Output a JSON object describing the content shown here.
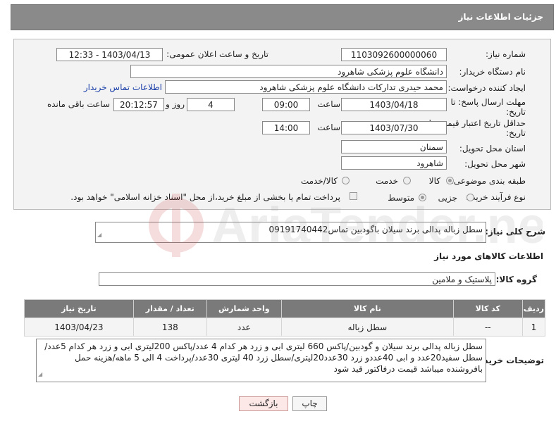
{
  "header": {
    "title": "جزئیات اطلاعات نیاز"
  },
  "form": {
    "need_number_label": "شماره نیاز:",
    "need_number": "1103092600000060",
    "announce_label": "تاریخ و ساعت اعلان عمومی:",
    "announce_value": "1403/04/13 - 12:33",
    "buyer_label": "نام دستگاه خریدار:",
    "buyer_value": "دانشگاه علوم پزشکی شاهرود",
    "creator_label": "ایجاد کننده درخواست:",
    "creator_value": "محمد حیدری تدارکات دانشگاه علوم پزشکی شاهرود",
    "contact_link": "اطلاعات تماس خریدار",
    "reply_label_1": "مهلت ارسال پاسخ: تا",
    "reply_label_2": "تاریخ:",
    "reply_date": "1403/04/18",
    "time_label": "ساعت",
    "reply_time": "09:00",
    "days_value": "4",
    "days_label": "روز و",
    "remain_time": "20:12:57",
    "remain_label": "ساعت باقی مانده",
    "validity_label_1": "حداقل تاریخ اعتبار قیمت: تا",
    "validity_label_2": "تاریخ:",
    "validity_date": "1403/07/30",
    "validity_time": "14:00",
    "province_label": "استان محل تحویل:",
    "province_value": "سمنان",
    "city_label": "شهر محل تحویل:",
    "city_value": "شاهرود",
    "category_label": "طبقه بندی موضوعی:",
    "category_options": [
      "کالا",
      "خدمت",
      "کالا/خدمت"
    ],
    "category_selected": "کالا",
    "process_label": "نوع فرآیند خرید :",
    "process_options": [
      "جزیی",
      "متوسط"
    ],
    "process_selected": "متوسط",
    "payment_note": "پرداخت تمام یا بخشی از مبلغ خرید،از محل \"اسناد خزانه اسلامی\" خواهد بود."
  },
  "description": {
    "label": "شرح کلی نیاز:",
    "value": "سطل زباله پدالی برند سیلان باگودبین تماس09191740442"
  },
  "goods_info_title": "اطلاعات کالاهای مورد نیاز",
  "goods_group": {
    "label": "گروه کالا:",
    "value": "پلاستیک و ملامین"
  },
  "table": {
    "headers": [
      "ردیف",
      "کد کالا",
      "نام کالا",
      "واحد شمارش",
      "تعداد / مقدار",
      "تاریخ نیاز"
    ],
    "rows": [
      [
        "1",
        "--",
        "سطل زباله",
        "عدد",
        "138",
        "1403/04/23"
      ]
    ]
  },
  "buyer_notes": {
    "label": "توضیحات خریدار:",
    "value": "سطل زباله پدالی برند سیلان و گودبین/پاکس 660 لیتری ابی و زرد هر کدام 4 عدد/پاکس 200لیتری ابی و زرد هر کدام 5عدد/سطل سفید20عدد و ابی 40عددو زرد 30عدد20لیتری/سطل زرد 40 لیتری 30عدد/پرداخت 4 الی 5 ماهه/هزینه حمل بافروشنده میباشد قیمت درفاکتور قید شود"
  },
  "buttons": {
    "print": "چاپ",
    "back": "بازگشت"
  },
  "watermark": {
    "text": "AriaTender.neT"
  }
}
